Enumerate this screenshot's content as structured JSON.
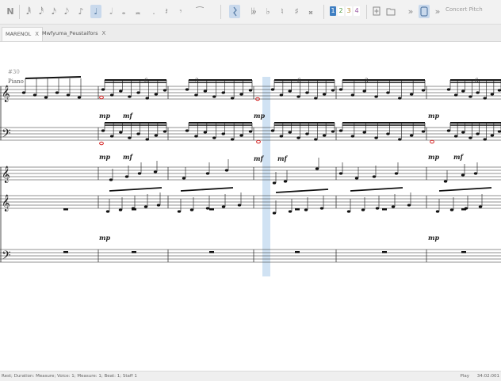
{
  "toolbar": {
    "note_input_icon": "N",
    "durations": [
      "𝅘𝅥𝅱",
      "𝅘𝅥𝅰",
      "𝅘𝅥𝅯",
      "𝅘𝅥𝅮",
      "♪",
      "♩",
      "𝅗𝅥",
      "𝅝",
      "𝅜"
    ],
    "dot": ".",
    "rests": [
      "𝄽",
      "𝄾"
    ],
    "accidentals": [
      "𝄫",
      "♭",
      "♮",
      "♯",
      "𝄪"
    ],
    "tie": "⁀",
    "voices": [
      "1",
      "2",
      "3",
      "4"
    ],
    "concert_pitch_label": "Concert Pitch"
  },
  "tabs": [
    {
      "label": "MARENOL",
      "close": "X"
    },
    {
      "label": "Mwfyuma_Peustaifors",
      "close": "X"
    }
  ],
  "score": {
    "measure_number": "#30",
    "instrument": "Piano",
    "tuplets": [
      "6",
      "3",
      "6",
      "3",
      "6"
    ],
    "dynamics": [
      "mp",
      "mf",
      "mp",
      "mf",
      "mp",
      "mf",
      "mp",
      "mf",
      "mp",
      "mf",
      "mp",
      "mf",
      "mp",
      "mf"
    ]
  },
  "status": {
    "text": "Rest; Duration: Measure; Voice: 1;  Measure: 1; Beat: 1; Staff 1",
    "mode": "Play",
    "time": "34:02:001"
  },
  "colors": {
    "selection": "#bcd5ee",
    "voice1": "#3f7fc2",
    "voice2": "#4f9a42",
    "voice3": "#b98a2a",
    "voice4": "#9b5aa3",
    "accent_red": "#d42020"
  }
}
